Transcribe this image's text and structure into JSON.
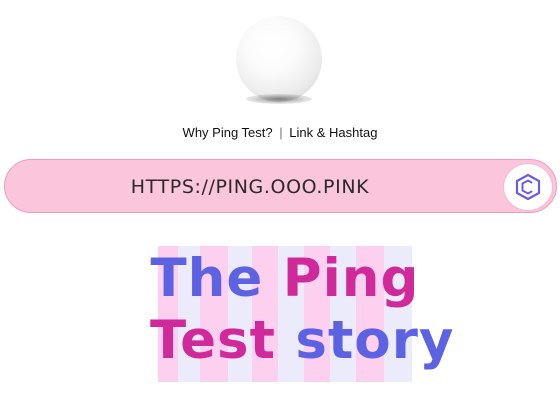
{
  "logo": {
    "icon": "white-ball-icon"
  },
  "nav": {
    "why_label": "Why Ping Test?",
    "separator": "|",
    "link_label": "Link & Hashtag"
  },
  "urlbar": {
    "url": "HTTPS://PING.OOO.PINK",
    "action_icon": "hexagon-icon"
  },
  "title": {
    "line1": [
      "The",
      "Ping"
    ],
    "line2": [
      "Test",
      "story"
    ]
  },
  "colors": {
    "urlbar_bg": "#fbc6dc",
    "accent_blue": "#5d62e2",
    "accent_magenta": "#d02a9a",
    "stripe_pink": "#fdd0ef",
    "stripe_lilac": "#ecebfb"
  }
}
